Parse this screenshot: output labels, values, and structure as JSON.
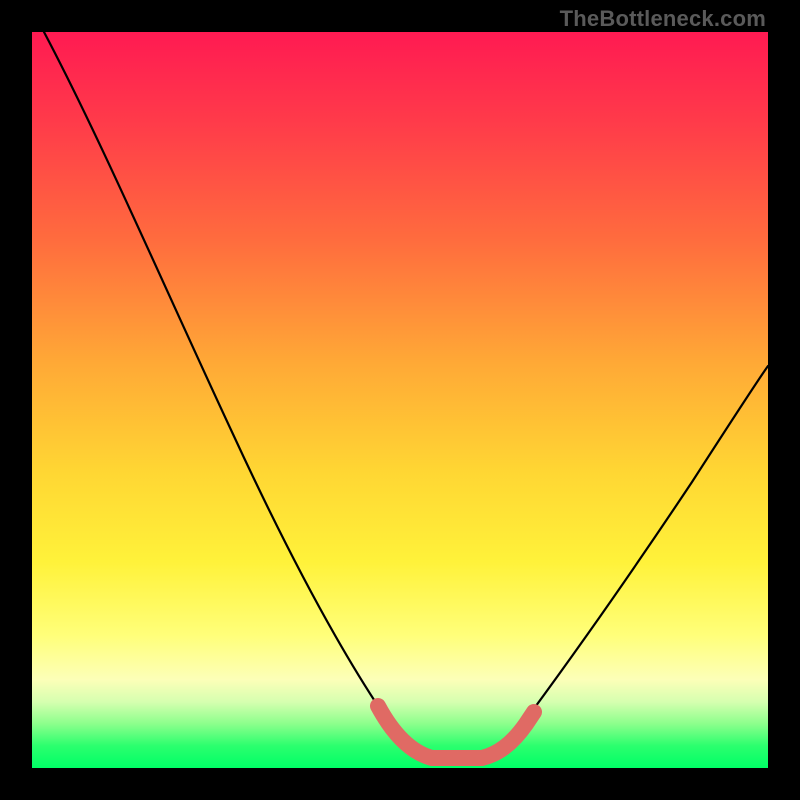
{
  "watermark": "TheBottleneck.com",
  "colors": {
    "valley_overlay": "#e06a64",
    "curve": "#000000",
    "gradient_top": "#ff1a52",
    "gradient_mid": "#ffe033",
    "gradient_bottom": "#00ff66"
  },
  "chart_data": {
    "type": "line",
    "title": "",
    "xlabel": "",
    "ylabel": "",
    "xlim": [
      0,
      100
    ],
    "ylim": [
      0,
      100
    ],
    "x": [
      0,
      5,
      10,
      15,
      20,
      25,
      30,
      35,
      40,
      45,
      47,
      50,
      53,
      55,
      58,
      60,
      62,
      65,
      70,
      75,
      80,
      85,
      90,
      95,
      100
    ],
    "values": [
      100,
      94,
      85,
      76,
      67,
      57,
      47,
      37,
      27,
      15,
      9,
      4,
      1,
      0,
      0,
      0,
      1,
      4,
      11,
      19,
      28,
      36,
      44,
      50,
      54
    ],
    "valley_range_x": [
      47,
      62
    ],
    "valley_annotation": "near-zero plateau highlighted",
    "notes": "x and y in percent of plot area; left branch starts at top-left, right branch ends ~54% height at right edge; minimum plateau around x≈55–60"
  }
}
